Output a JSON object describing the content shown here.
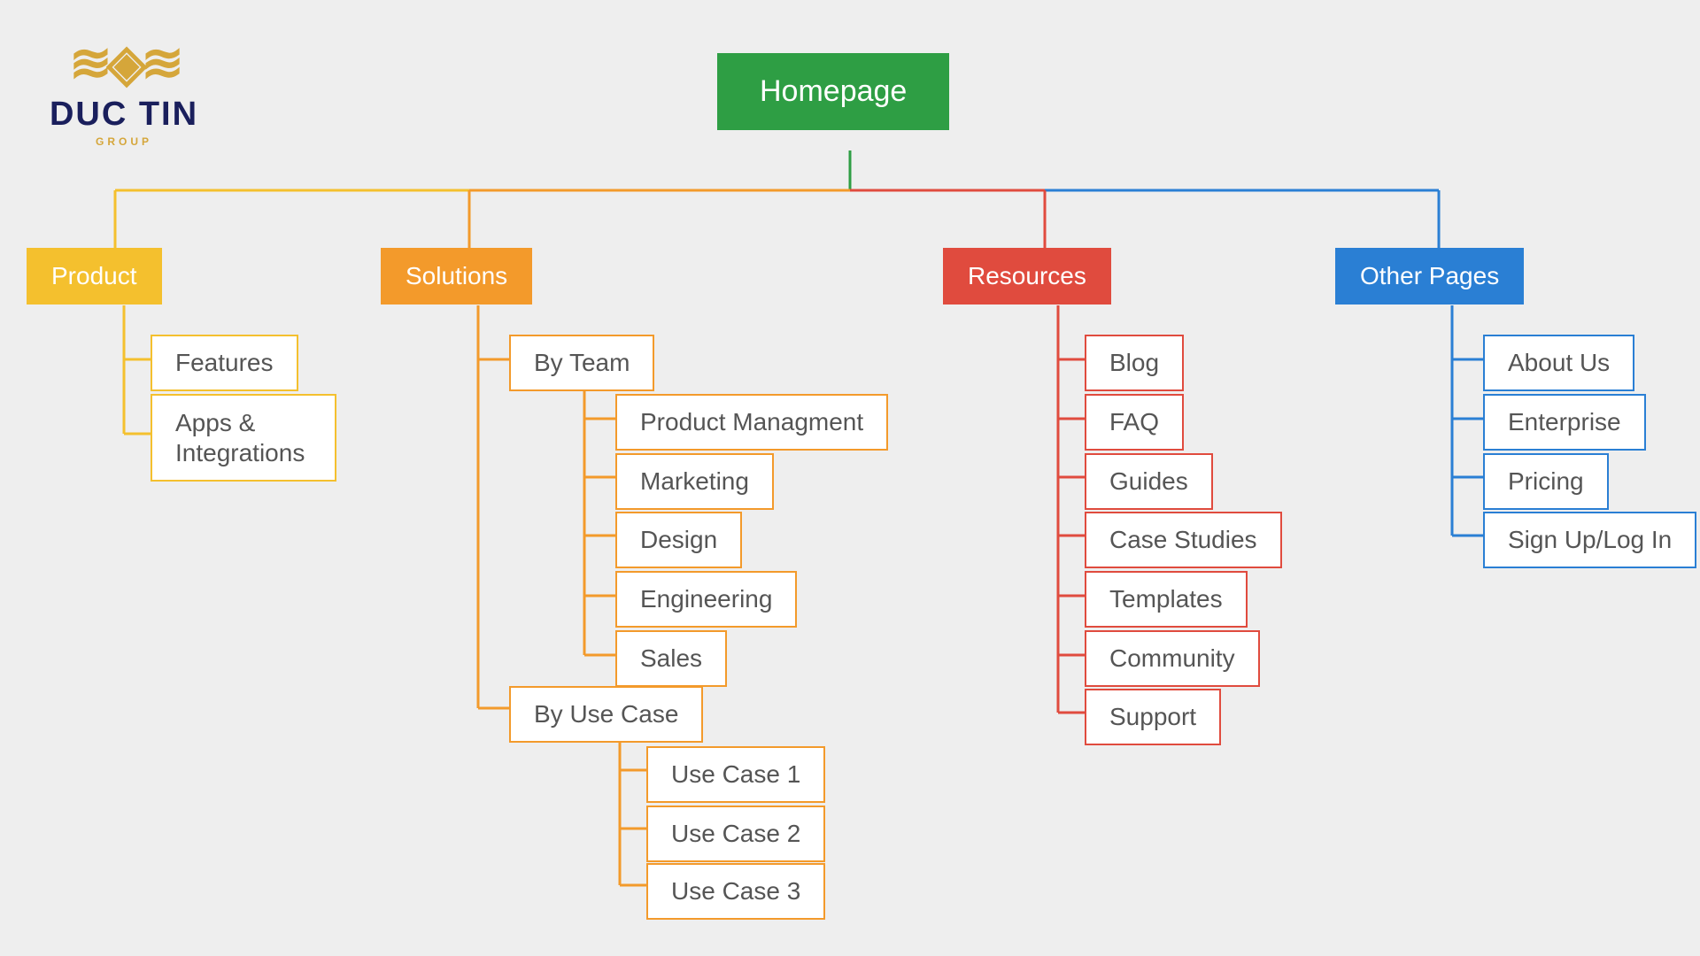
{
  "logo": {
    "name": "DUC TIN",
    "sub": "GROUP"
  },
  "root": "Homepage",
  "product": {
    "title": "Product",
    "children": [
      "Features",
      "Apps & Integrations"
    ]
  },
  "solutions": {
    "title": "Solutions",
    "groups": [
      {
        "title": "By Team",
        "children": [
          "Product Managment",
          "Marketing",
          "Design",
          "Engineering",
          "Sales"
        ]
      },
      {
        "title": "By Use Case",
        "children": [
          "Use Case 1",
          "Use Case 2",
          "Use Case 3"
        ]
      }
    ]
  },
  "resources": {
    "title": "Resources",
    "children": [
      "Blog",
      "FAQ",
      "Guides",
      "Case Studies",
      "Templates",
      "Community",
      "Support"
    ]
  },
  "other": {
    "title": "Other Pages",
    "children": [
      "About Us",
      "Enterprise",
      "Pricing",
      "Sign Up/Log In"
    ]
  },
  "colors": {
    "yellow": "#f4c02e",
    "orange": "#f39a2b",
    "red": "#e04b3e",
    "blue": "#2a7fd4",
    "green": "#2e9e44"
  }
}
